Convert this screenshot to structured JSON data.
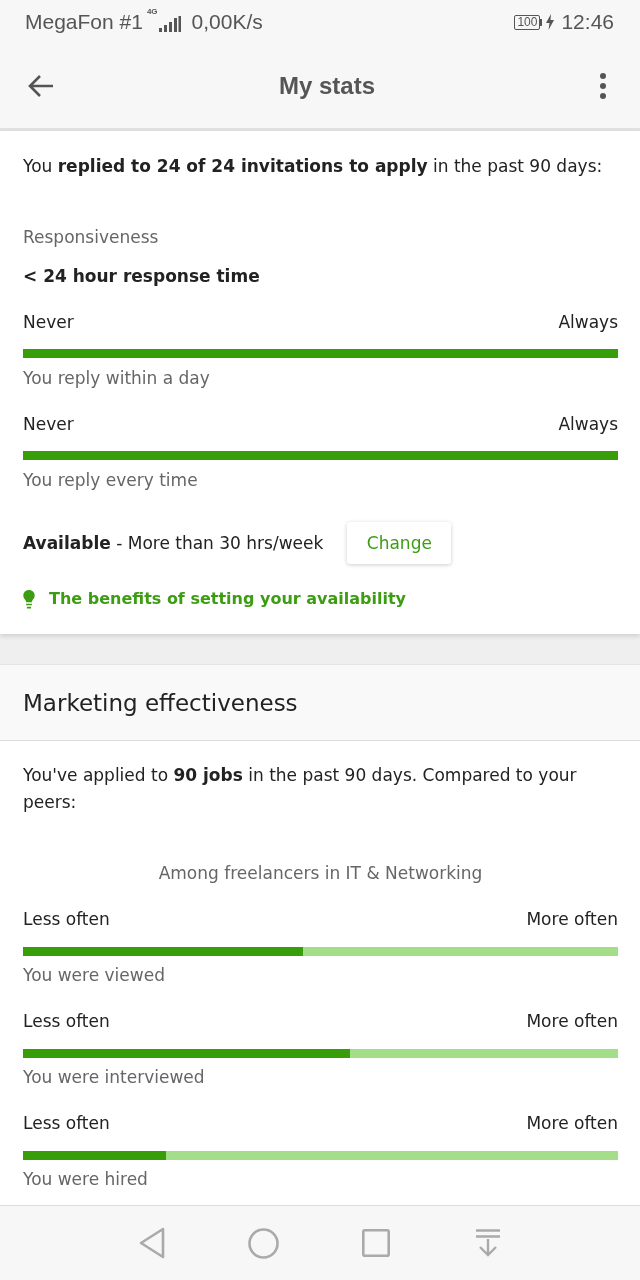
{
  "status_bar": {
    "carrier": "MegaFon #1",
    "network_type": "4G",
    "speed": "0,00K/s",
    "battery": "100",
    "charging": true,
    "time": "12:46"
  },
  "app_bar": {
    "title": "My stats"
  },
  "responsiveness": {
    "intro": "You **replied to 24 of 24 invitations to apply** in the past 90 days:",
    "label": "Responsiveness",
    "heading": "< 24 hour response time",
    "meters": [
      {
        "min_label": "Never",
        "max_label": "Always",
        "level": 1,
        "caption": "You reply within a day"
      },
      {
        "min_label": "Never",
        "max_label": "Always",
        "level": 1,
        "caption": "You reply every time"
      }
    ],
    "availability": "**Available** - More than 30 hrs/week",
    "change_button": "Change",
    "benefits_link": "The benefits of setting your availability"
  },
  "marketing": {
    "title": "Marketing effectiveness",
    "intro": "You've applied to **90 jobs** in the past 90 days. Compared to your peers:",
    "peer_group": "Among freelancers in IT & Networking",
    "meters": [
      {
        "min_label": "Less often",
        "max_label": "More often",
        "level": 0.47,
        "caption": "You were viewed"
      },
      {
        "min_label": "Less often",
        "max_label": "More often",
        "level": 0.55,
        "caption": "You were interviewed"
      },
      {
        "min_label": "Less often",
        "max_label": "More often",
        "level": 0.24,
        "caption": "You were hired"
      }
    ]
  }
}
